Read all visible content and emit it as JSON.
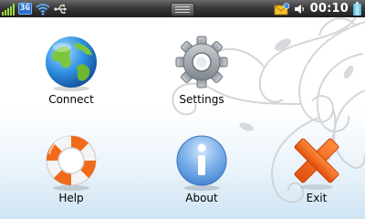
{
  "status_bar": {
    "network": "3G",
    "time": "00:10",
    "icons": [
      "signal-strength-icon",
      "3g-icon",
      "wifi-icon",
      "usb-icon",
      "menu-handle-icon",
      "new-message-icon",
      "sound-icon",
      "battery-icon"
    ]
  },
  "apps": [
    {
      "label": "Connect",
      "icon": "globe-icon"
    },
    {
      "label": "Settings",
      "icon": "gear-icon"
    },
    {
      "label": "Help",
      "icon": "lifebuoy-icon"
    },
    {
      "label": "About",
      "icon": "info-icon"
    },
    {
      "label": "Exit",
      "icon": "close-x-icon"
    }
  ],
  "colors": {
    "accent_blue": "#4a90d9",
    "exit_orange": "#f26a1b",
    "signal_green": "#9bd83c"
  }
}
